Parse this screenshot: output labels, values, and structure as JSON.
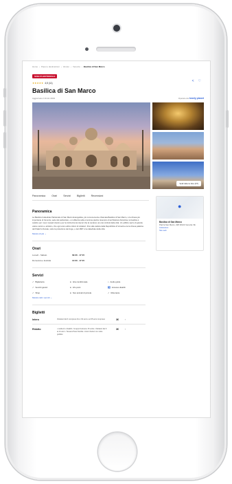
{
  "breadcrumb": [
    "Home",
    "Paesi e destinazioni",
    "Veneto",
    "Venezia",
    "Basilica di San Marco"
  ],
  "badge": "SCELTA EDITORIALE",
  "rating": {
    "stars": "★★★★★",
    "value": "4,5 (11)"
  },
  "title": "Basilica di San Marco",
  "meta": {
    "left": "Aggiornato il 10 dic 2019",
    "right_label": "Operato da",
    "brand": "lonely planet"
  },
  "gallery": {
    "view_all": "Vedi tutte le foto (37)"
  },
  "tabs": [
    "Panoramica",
    "Orari",
    "Servizi",
    "Biglietti",
    "Recensioni"
  ],
  "overview": {
    "title": "Panoramica",
    "text": "La Basilica Cattedrale Patriarcale di San Marco Evangelista, più comunemente chiamata Basilica di San Marco, è la chiesa più importante di Venezia, sede del patriarcato, e si affaccia sulla omonima piazza. Esempio di architettura bizantina, la basilica è celebre per i suoi mosaici dorati e per la ricchezza dei decori che la rendono uno dei simboli della città. Un edificio sacro di grande valore storico e artistico, che ogni anno attira milioni di visitatori. Fino alla caduta della Repubblica di Venezia era la chiesa palatina del Palazzo Ducale, sotto la protezione del doge, e dal 1807 è la cattedrale della città.",
    "more": "Mostra di più ⌄"
  },
  "hours": {
    "title": "Orari",
    "rows": [
      {
        "day": "Lunedì - Sabato",
        "time": "09:30 - 17:15"
      },
      {
        "day": "Domenica e festività",
        "time": "14:00 - 17:15"
      }
    ]
  },
  "services": {
    "title": "Servizi",
    "items": [
      {
        "icon": "✓",
        "label": "Biglietteria"
      },
      {
        "icon": "●",
        "label": "Aria condizionata"
      },
      {
        "icon": "♪",
        "label": "Audio guide"
      },
      {
        "icon": "✓",
        "label": "Servizi igienici"
      },
      {
        "icon": "●",
        "label": "Info point"
      },
      {
        "icon": "♿",
        "label": "Accesso disabili"
      },
      {
        "icon": "✓",
        "label": "Shop"
      },
      {
        "icon": "●",
        "label": "Non animali di piccola"
      },
      {
        "icon": "✓",
        "label": "Ristorante"
      }
    ],
    "more": "Mostra tutti i servizi ⌄"
  },
  "tickets": {
    "title": "Biglietti",
    "rows": [
      {
        "name": "Intero",
        "desc": "Visitatori dal 6 compreso fino i 64 anni e ai 65 anni compreso",
        "price": "3€",
        "chev": "›"
      },
      {
        "name": "Ridotto",
        "desc": "• residenti • disabili • Gruppi di almeno 15 unità • Visitatori dai 6 ai 14 anni • Tessera Pass Familia • Giorni festivi con visite guidate",
        "price": "3€",
        "chev": "›"
      }
    ]
  },
  "map": {
    "name": "Basilica di San Marco",
    "address": "Piazza San Marco, 328 30124 Venezia VE",
    "directions": "Indicazioni",
    "site": "Sito web"
  },
  "colors": {
    "accent": "#2b5fd8",
    "badge": "#c8102e",
    "stars": "#e4a300"
  },
  "icons": {
    "share": "share-icon",
    "favorite": "heart-icon",
    "pin": "map-pin-icon"
  }
}
